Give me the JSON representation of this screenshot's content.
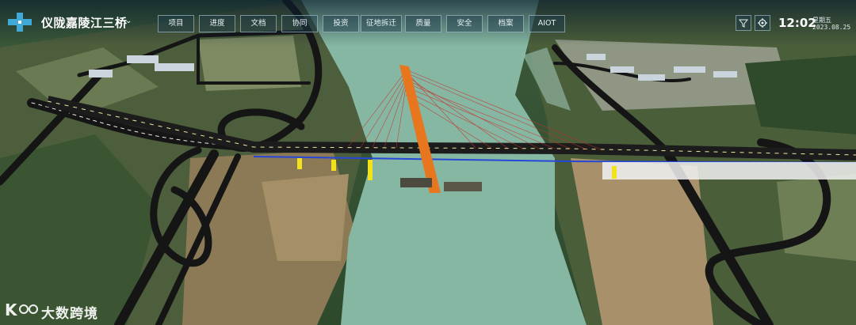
{
  "header": {
    "title": "仪陇嘉陵江三桥",
    "title_dropdown_icon": "chevron-down-icon",
    "logo_icon": "cross-logo-icon",
    "accent_color": "#3fa9d8"
  },
  "nav": {
    "tabs": [
      {
        "label": "项目"
      },
      {
        "label": "进度"
      },
      {
        "label": "文档"
      },
      {
        "label": "协同"
      },
      {
        "label": "投资"
      },
      {
        "label": "征地拆迁"
      },
      {
        "label": "质量"
      },
      {
        "label": "安全"
      },
      {
        "label": "档案"
      },
      {
        "label": "AIOT"
      }
    ]
  },
  "controls": {
    "filter_icon": "funnel-icon",
    "settings_icon": "gear-icon"
  },
  "status": {
    "time": "12:02",
    "weekday": "星期五",
    "date": "2023.08.25"
  },
  "watermark": {
    "text": "大数跨境"
  },
  "scene": {
    "river_color": "#86b7a2",
    "pylon_color": "#e8761e",
    "cable_color": "#c8302a",
    "deck_color": "#1c1c1c"
  }
}
